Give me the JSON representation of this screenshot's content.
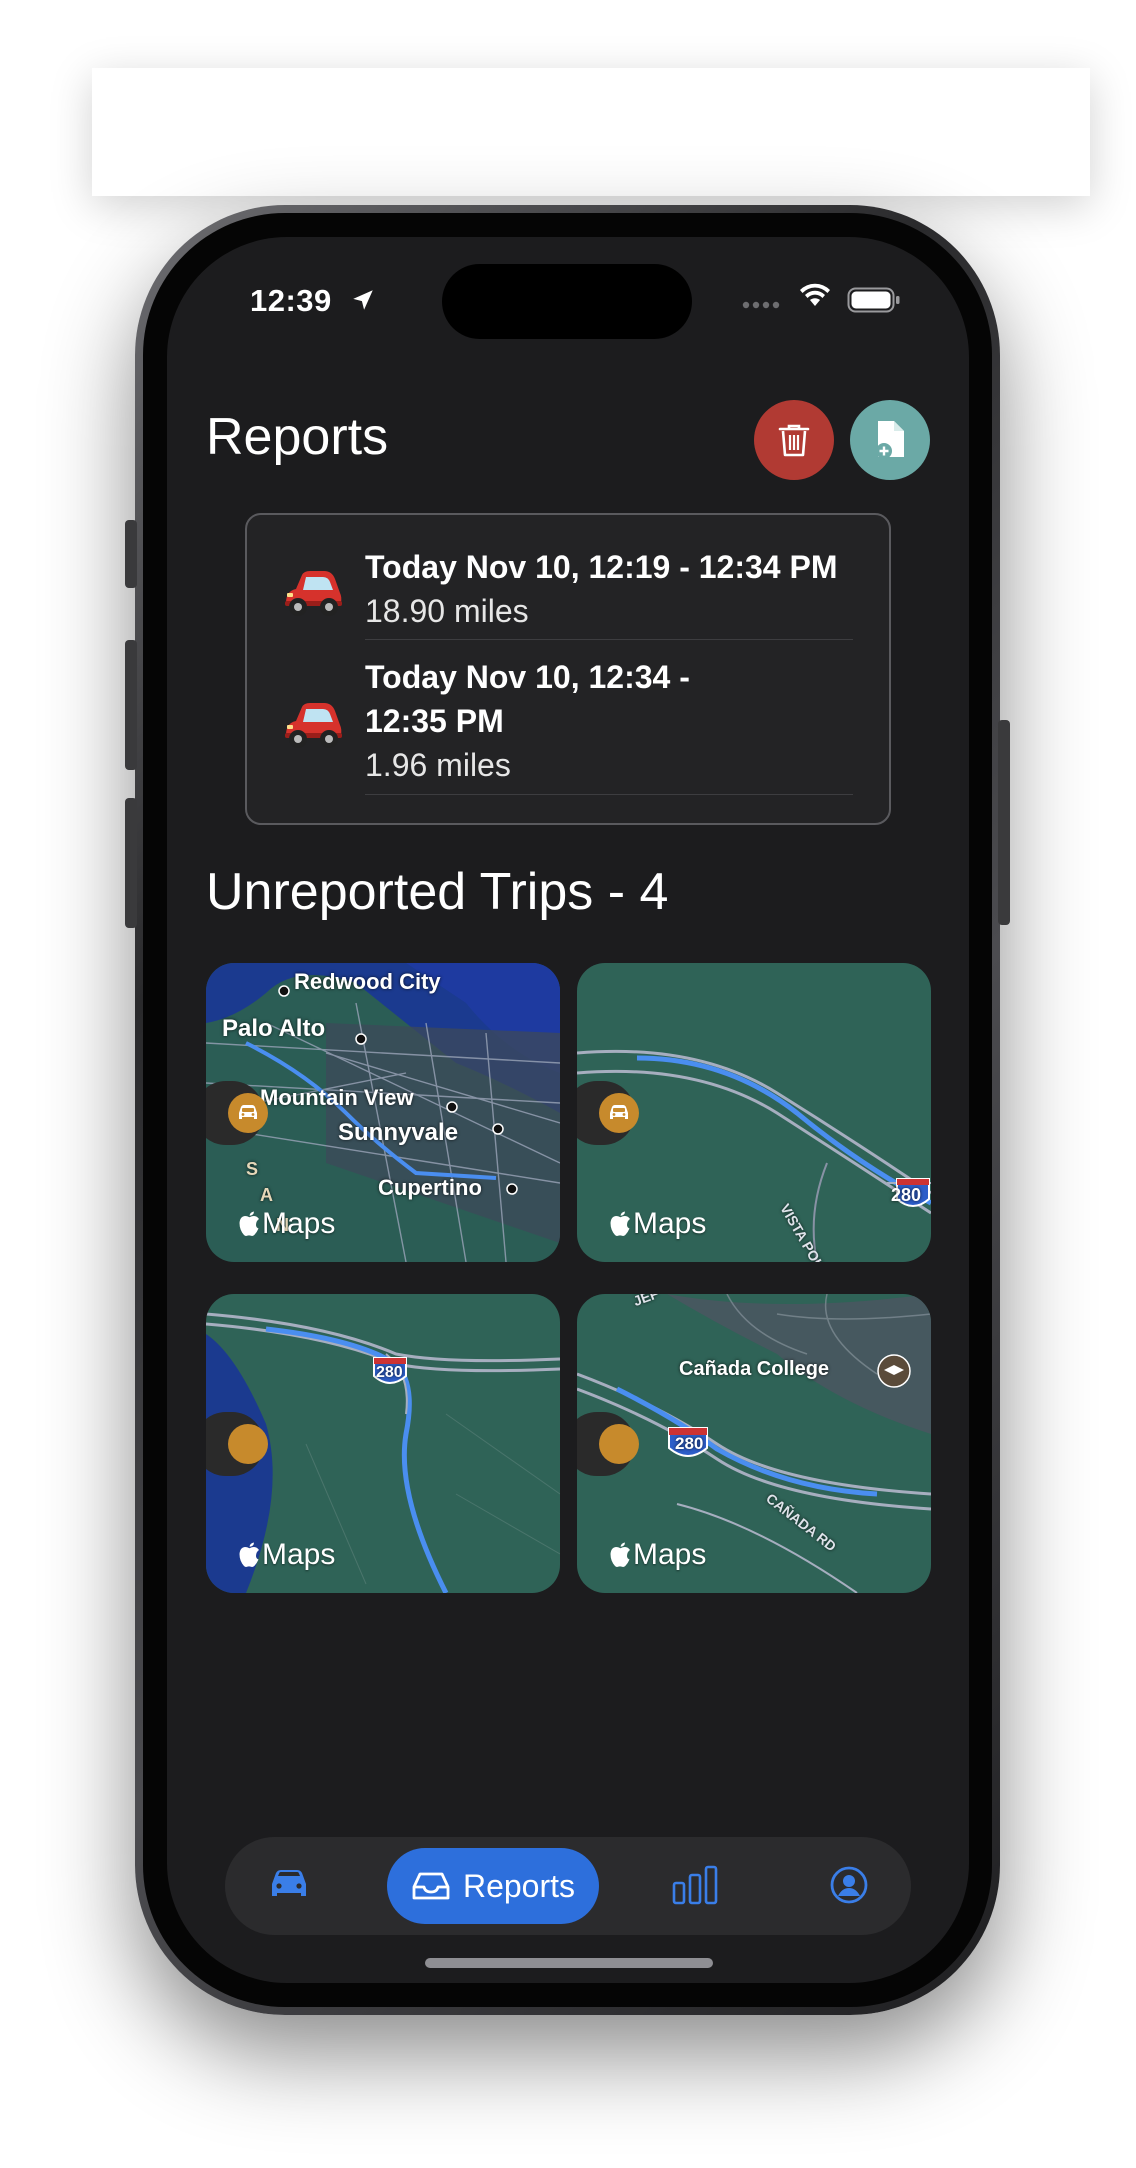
{
  "status_bar": {
    "time": "12:39",
    "location_icon": "location-arrow-icon",
    "signal_icon": "cellular-dots-icon",
    "wifi_icon": "wifi-icon",
    "battery_icon": "battery-icon"
  },
  "header": {
    "title": "Reports",
    "delete_icon": "trash-icon",
    "new_report_icon": "document-add-icon",
    "delete_color": "#b13a33",
    "new_report_color": "#6ba9a6"
  },
  "reported_trips": [
    {
      "icon": "car-emoji-icon",
      "title": "Today Nov 10, 12:19 - 12:34 PM",
      "distance": "18.90 miles"
    },
    {
      "icon": "car-emoji-icon",
      "title_line1": "Today Nov 10, 12:34 -",
      "title_line2": "12:35 PM",
      "distance": "1.96 miles"
    }
  ],
  "unreported": {
    "title": "Unreported Trips - 4",
    "tiles": [
      {
        "badge_icon": "car-icon",
        "attribution": "Maps",
        "labels": [
          "Redwood City",
          "Palo Alto",
          "Mountain View",
          "Sunnyvale",
          "Cupertino",
          "S",
          "A",
          "N"
        ]
      },
      {
        "badge_icon": "car-icon",
        "attribution": "Maps",
        "labels": [
          "VISTA POINT RD",
          "280"
        ]
      },
      {
        "badge_icon": "unknown-dot-icon",
        "attribution": "Maps",
        "labels": [
          "280"
        ]
      },
      {
        "badge_icon": "unknown-dot-icon",
        "attribution": "Maps",
        "labels": [
          "Cañada College",
          "280",
          "CAÑADA RD",
          "JEF"
        ]
      }
    ],
    "badge_color": "#c78a2c"
  },
  "tab_bar": {
    "items": [
      {
        "icon": "car-icon",
        "label": ""
      },
      {
        "icon": "tray-icon",
        "label": "Reports",
        "selected": true
      },
      {
        "icon": "bar-chart-icon",
        "label": ""
      },
      {
        "icon": "person-circle-icon",
        "label": ""
      }
    ],
    "accent": "#2d6fdc"
  }
}
